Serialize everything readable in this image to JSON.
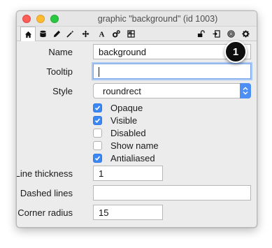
{
  "window": {
    "title": "graphic \"background\" (id 1003)",
    "buttons": [
      "close",
      "minimize",
      "zoom"
    ]
  },
  "toolbar": {
    "left_tools": [
      "home-icon",
      "database-icon",
      "pencil-icon",
      "magic-wand-icon",
      "move-arrows-icon",
      "text-a-icon",
      "gears-icon",
      "grid-icon"
    ],
    "right_tools": [
      "lock-icon",
      "import-icon",
      "target-icon",
      "gear-icon"
    ],
    "active_tool": "home-icon"
  },
  "form": {
    "name_label": "Name",
    "name_value": "background",
    "tooltip_label": "Tooltip",
    "tooltip_value": "",
    "style_label": "Style",
    "style_value": "roundrect",
    "checkboxes": [
      {
        "label": "Opaque",
        "checked": true
      },
      {
        "label": "Visible",
        "checked": true
      },
      {
        "label": "Disabled",
        "checked": false
      },
      {
        "label": "Show name",
        "checked": false
      },
      {
        "label": "Antialiased",
        "checked": true
      }
    ],
    "line_thickness_label": "Line thickness",
    "line_thickness_value": "1",
    "dashed_lines_label": "Dashed lines",
    "dashed_lines_value": "",
    "corner_radius_label": "Corner radius",
    "corner_radius_value": "15"
  },
  "annotation": {
    "number": "1"
  },
  "colors": {
    "accent": "#3b87f6",
    "badge": "#0e0e0e"
  }
}
